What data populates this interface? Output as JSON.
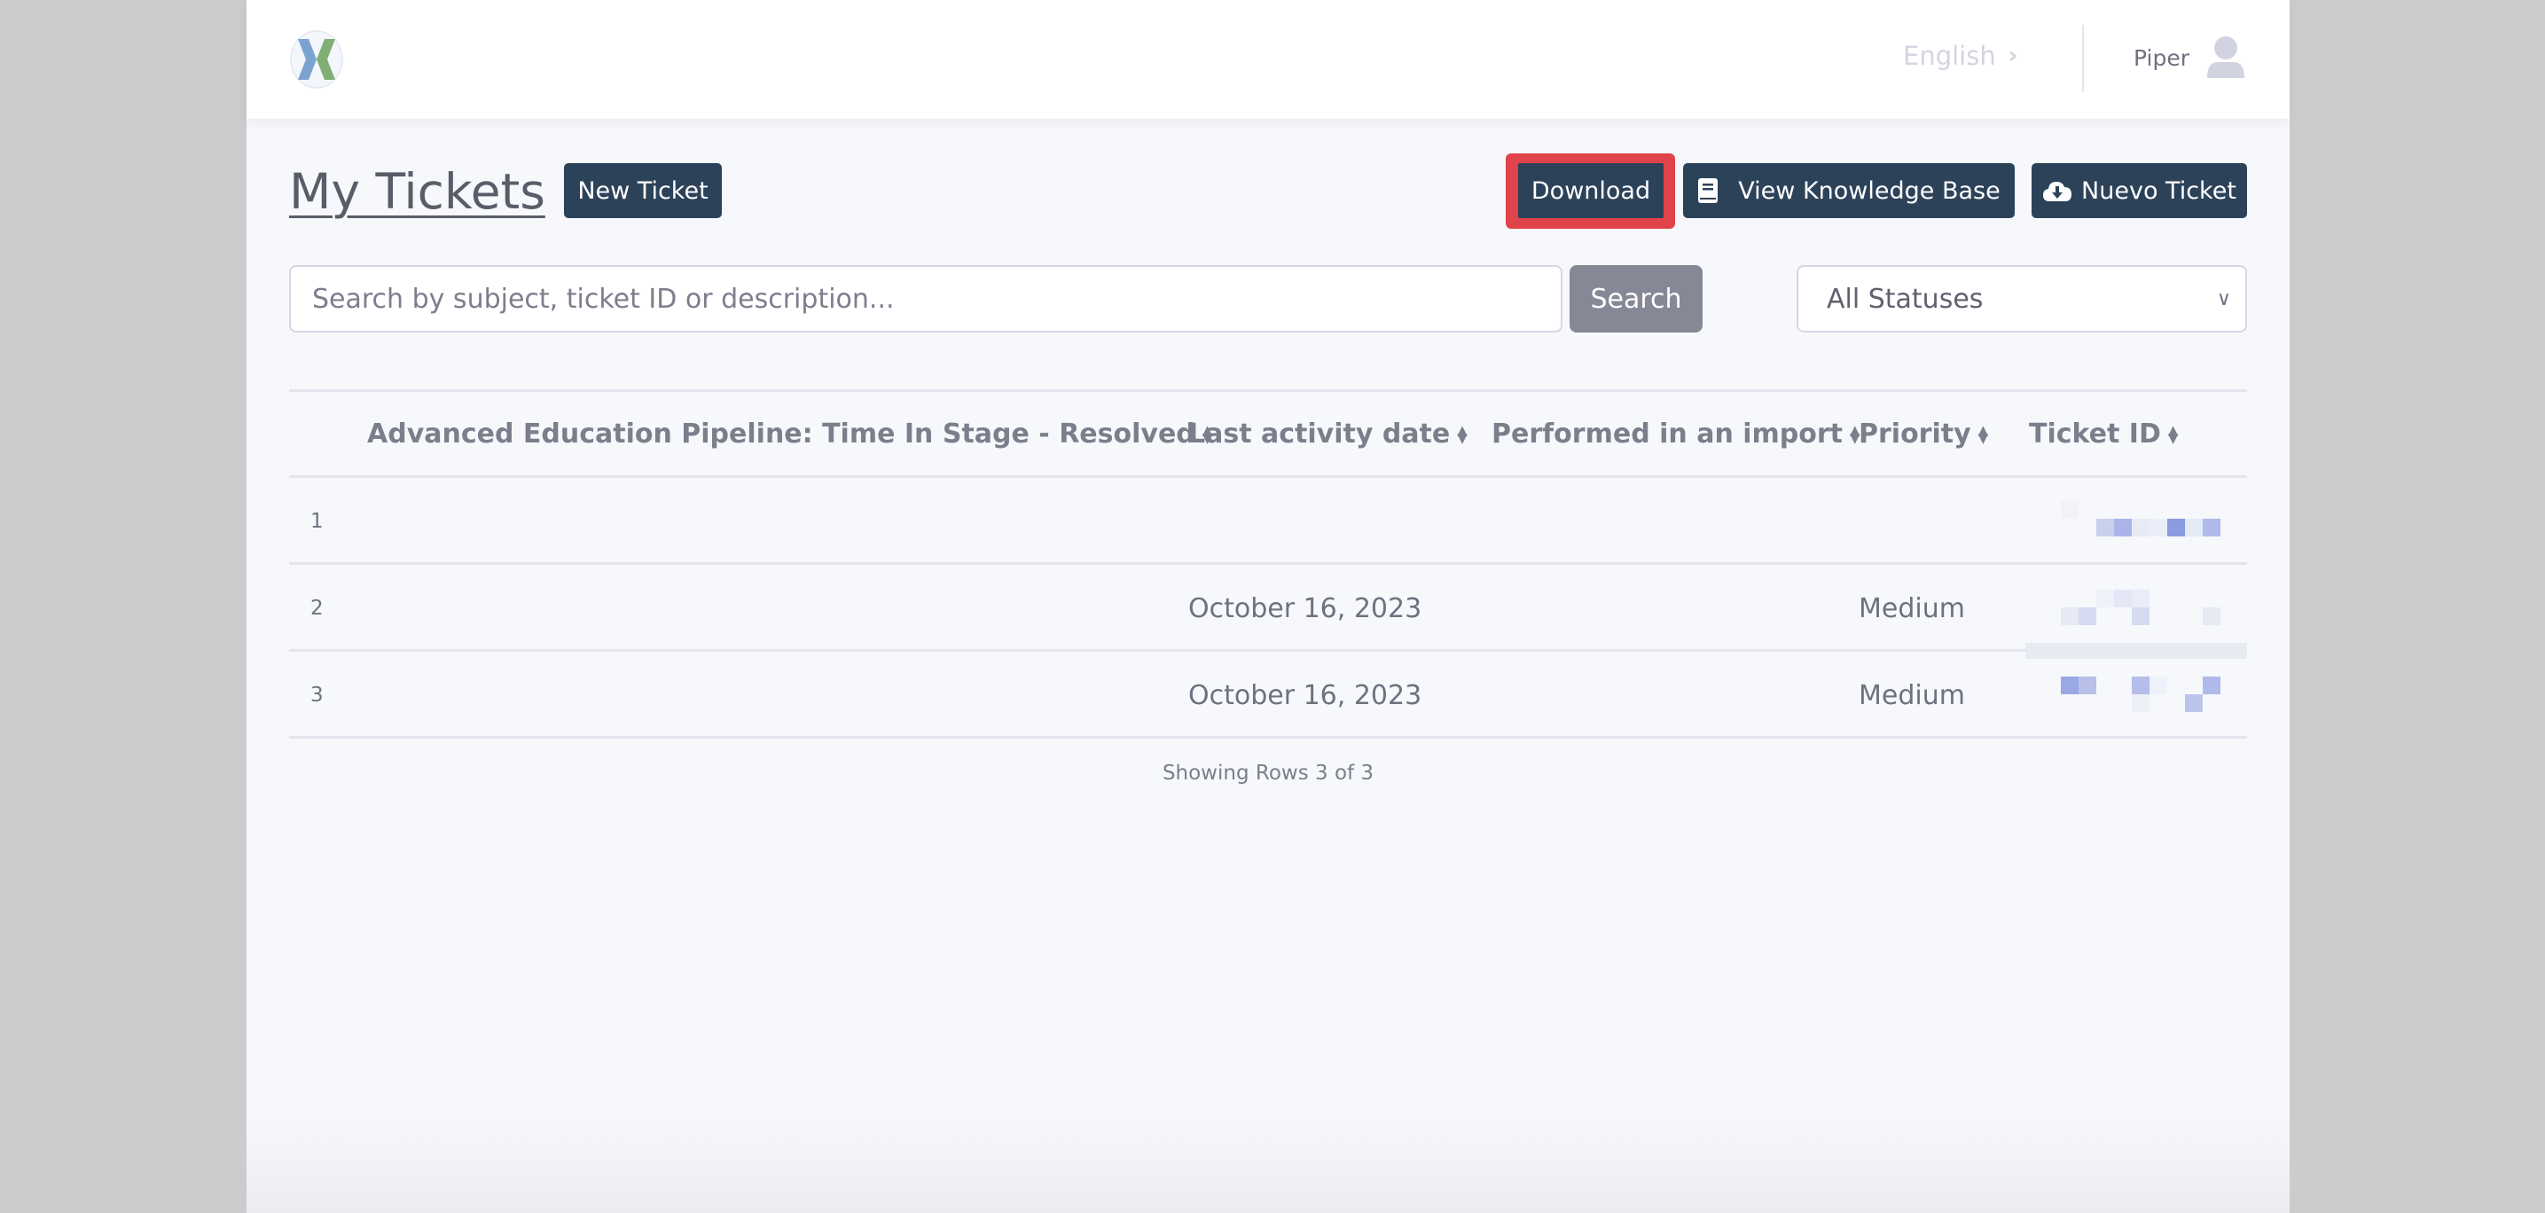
{
  "navbar": {
    "logo_alt": "X brain logo",
    "language": "English",
    "user_name": "Piper"
  },
  "header": {
    "title": "My Tickets",
    "new_ticket_label": "New Ticket",
    "download_label": "Download",
    "knowledge_base_label": "View Knowledge Base",
    "nuevo_ticket_label": "Nuevo Ticket"
  },
  "search": {
    "placeholder": "Search by subject, ticket ID or description...",
    "value": "",
    "button_label": "Search",
    "status_filter": "All Statuses"
  },
  "table": {
    "columns": [
      "Advanced Education Pipeline: Time In Stage - Resolved",
      "Last activity date",
      "Performed in an import",
      "Priority",
      "Ticket ID"
    ],
    "rows": [
      {
        "num": "1",
        "time_in_stage": "",
        "last_activity": "",
        "performed_in_import": "",
        "priority": "",
        "ticket_id": "[redacted]"
      },
      {
        "num": "2",
        "time_in_stage": "",
        "last_activity": "October 16, 2023",
        "performed_in_import": "",
        "priority": "Medium",
        "ticket_id": "[redacted]"
      },
      {
        "num": "3",
        "time_in_stage": "",
        "last_activity": "October 16, 2023",
        "performed_in_import": "",
        "priority": "Medium",
        "ticket_id": "[redacted]"
      }
    ],
    "footer": "Showing Rows 3 of 3"
  },
  "colors": {
    "primary_button": "#2c4259",
    "highlight_border": "#e1434a",
    "search_button": "#878896",
    "logo_blue": "#7ba3d0",
    "logo_green": "#7faf74"
  }
}
